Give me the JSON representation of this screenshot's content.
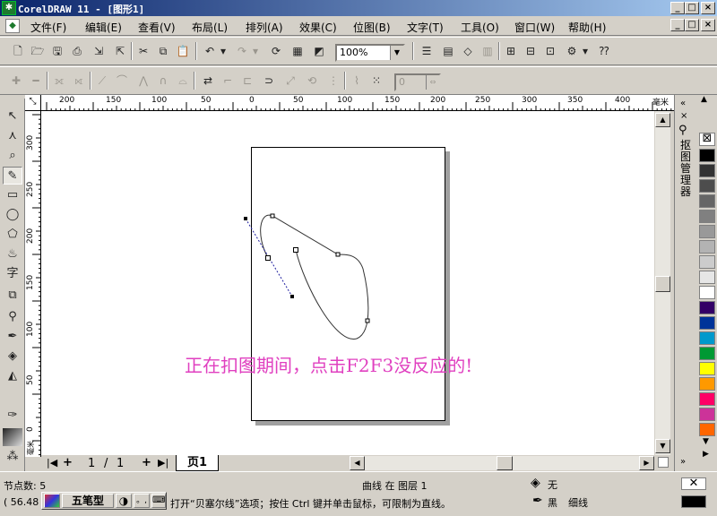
{
  "window": {
    "title": "CorelDRAW 11 - [图形1]",
    "min": "_",
    "max": "□",
    "close": "×"
  },
  "menu": [
    "文件(F)",
    "编辑(E)",
    "查看(V)",
    "布局(L)",
    "排列(A)",
    "效果(C)",
    "位图(B)",
    "文字(T)",
    "工具(O)",
    "窗口(W)",
    "帮助(H)"
  ],
  "standard_toolbar": {
    "zoom_value": "100%"
  },
  "property_bar": {
    "value": "0"
  },
  "ruler": {
    "unit": "毫米",
    "h_labels": [
      "200",
      "150",
      "100",
      "50",
      "0",
      "50",
      "100",
      "150",
      "200",
      "250",
      "300",
      "350",
      "400"
    ],
    "v_labels": [
      "300",
      "250",
      "200",
      "150",
      "100",
      "50",
      "0"
    ]
  },
  "canvas": {
    "annotation": "正在扣图期间，点击F2F3没反应的!"
  },
  "pages": {
    "current": "1",
    "separator": "/",
    "total": "1",
    "tab": "页1"
  },
  "docker": {
    "title": "抠图管理器"
  },
  "palette": {
    "colors": [
      "#000000",
      "#333333",
      "#4d4d4d",
      "#666666",
      "#808080",
      "#999999",
      "#b3b3b3",
      "#cccccc",
      "#e6e6e6",
      "#ffffff",
      "#330066",
      "#003399",
      "#0099cc",
      "#009933",
      "#ffff00",
      "#ff9900",
      "#ff0066",
      "#cc3399",
      "#ff6600"
    ]
  },
  "status": {
    "nodes": "节点数: 5",
    "coords": "( 56.48",
    "object_info": "曲线  在  图层 1",
    "hint": "打开“贝塞尔线”选项；按住 Ctrl 键并单击鼠标，可限制为直线。",
    "fill": "无",
    "outline_color": "黑",
    "outline_width": "细线",
    "ime_name": "五笔型",
    "ime_punct": "。,"
  }
}
